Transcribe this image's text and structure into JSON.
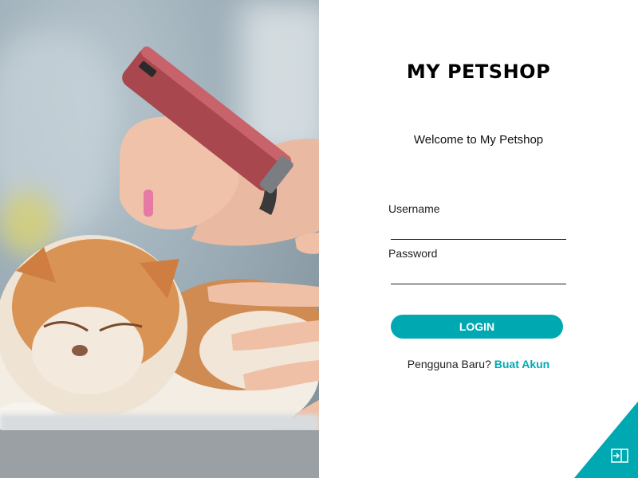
{
  "photo": {
    "alt": "Groomer trimming a Persian cat"
  },
  "brand": {
    "title": "MY PETSHOP"
  },
  "welcome": {
    "text": "Welcome to My Petshop"
  },
  "form": {
    "username_label": "Username",
    "username_value": "",
    "password_label": "Password",
    "password_value": "",
    "login_label": "LOGIN"
  },
  "signup": {
    "prompt": "Pengguna Baru?",
    "link": "Buat Akun"
  },
  "corner": {
    "icon": "exit-icon"
  },
  "colors": {
    "accent": "#00a9b2",
    "text": "#222222",
    "background": "#ffffff"
  }
}
